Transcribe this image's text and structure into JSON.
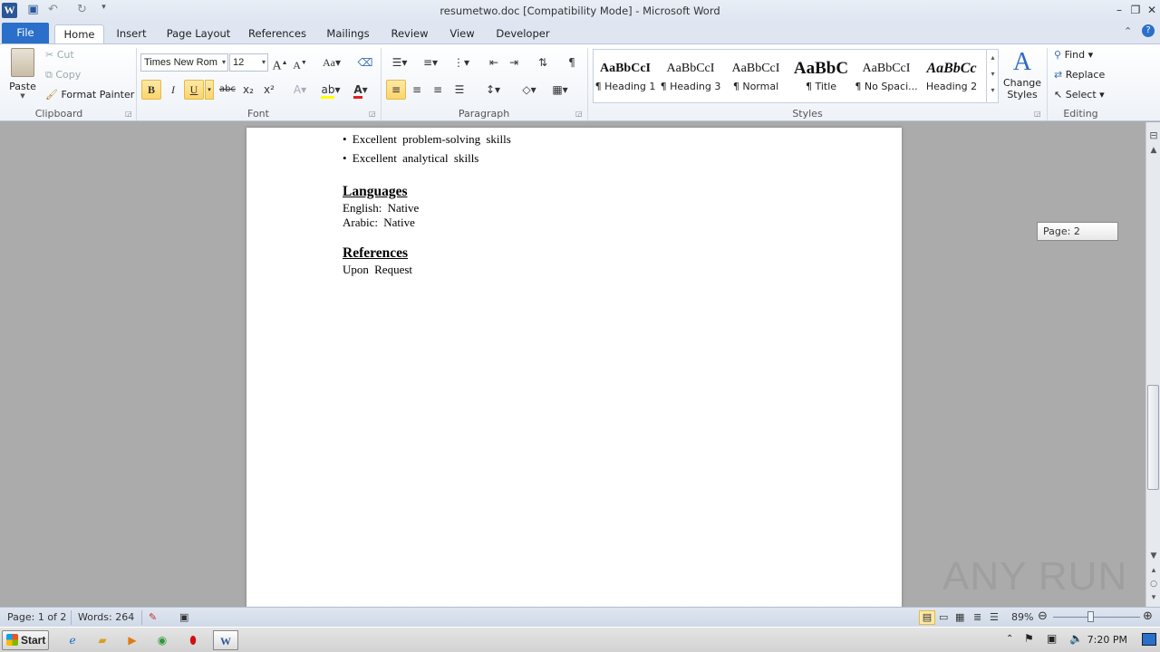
{
  "window": {
    "title": "resumetwo.doc [Compatibility Mode]  -  Microsoft Word"
  },
  "tabs": [
    "File",
    "Home",
    "Insert",
    "Page Layout",
    "References",
    "Mailings",
    "Review",
    "View",
    "Developer"
  ],
  "clipboard": {
    "paste": "Paste",
    "cut": "Cut",
    "copy": "Copy",
    "format_painter": "Format Painter",
    "label": "Clipboard"
  },
  "font": {
    "name": "Times New Rom",
    "size": "12",
    "label": "Font",
    "grow": "A",
    "shrink": "A",
    "case": "Aa",
    "bold": "B",
    "italic": "I",
    "underline": "U",
    "strike": "abc",
    "sub": "x₂",
    "sup": "x²"
  },
  "paragraph": {
    "label": "Paragraph",
    "pilcrow": "¶"
  },
  "styles": {
    "label": "Styles",
    "items": [
      {
        "sample": "AaBbCcI",
        "name": "¶ Heading 1"
      },
      {
        "sample": "AaBbCcI",
        "name": "¶ Heading 3"
      },
      {
        "sample": "AaBbCcI",
        "name": "¶ Normal"
      },
      {
        "sample": "AaBbC",
        "name": "¶ Title"
      },
      {
        "sample": "AaBbCcI",
        "name": "¶ No Spaci..."
      },
      {
        "sample": "AaBbCc",
        "name": "Heading 2"
      }
    ],
    "change_styles": "Change Styles"
  },
  "editing": {
    "label": "Editing",
    "find": "Find",
    "replace": "Replace",
    "select": "Select"
  },
  "document": {
    "bullets": [
      "• Excellent  problem-solving  skills",
      "• Excellent  analytical  skills"
    ],
    "languages_heading": "Languages",
    "languages": [
      "English:  Native",
      "Arabic:  Native"
    ],
    "references_heading": "References",
    "references_text": "Upon Request"
  },
  "page_tip": "Page: 2",
  "status": {
    "page": "Page: 1 of 2",
    "words": "Words: 264",
    "zoom": "89%"
  },
  "taskbar": {
    "start": "Start",
    "clock": "7:20 PM"
  },
  "watermark": "ANY RUN"
}
